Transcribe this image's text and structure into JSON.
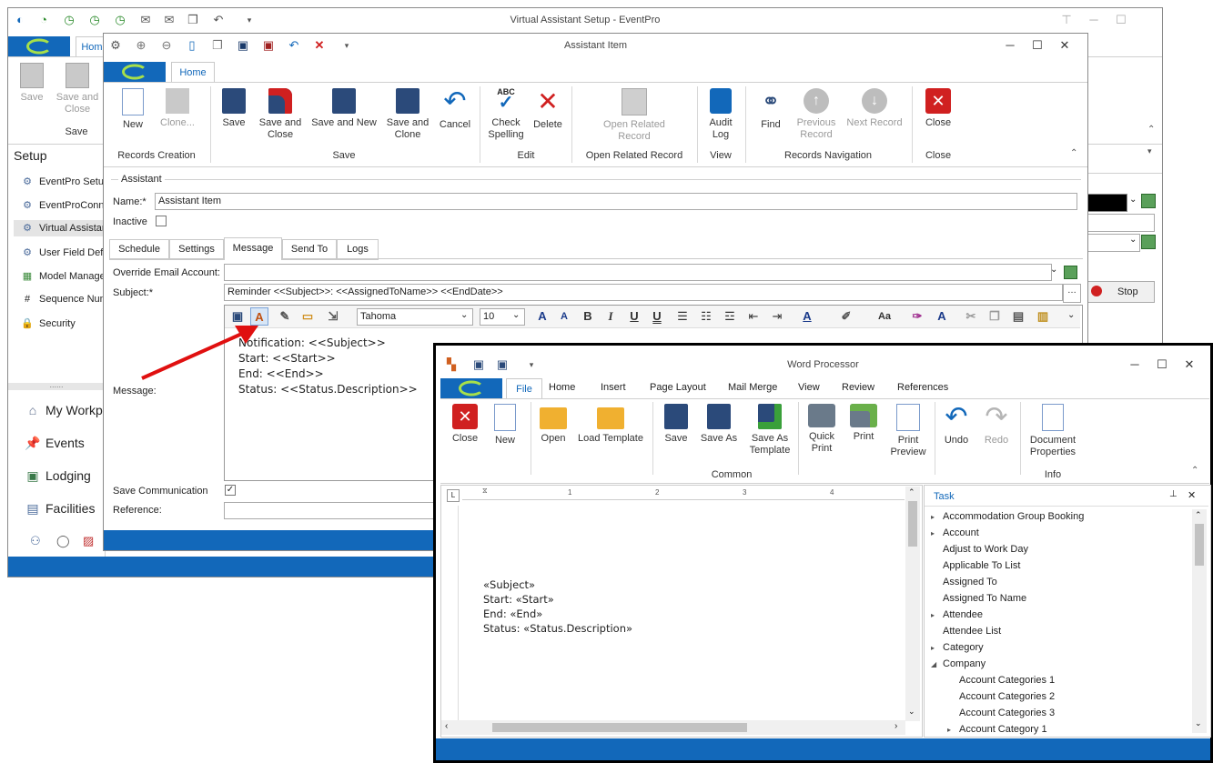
{
  "main_window": {
    "title": "Virtual Assistant Setup - EventPro",
    "tab_home": "Home",
    "save": {
      "line1": "Save",
      "line2": ""
    },
    "save_close": {
      "line1": "Save and",
      "line2": "Close"
    },
    "group_save": "Save",
    "sidebar_header": "Setup",
    "sidebar_items": [
      {
        "label": "EventPro Setup",
        "icon": "gear-icon"
      },
      {
        "label": "EventProConne",
        "icon": "gear-icon"
      },
      {
        "label": "Virtual Assistant",
        "icon": "gear-icon"
      },
      {
        "label": "User Field Defini",
        "icon": "gear-icon"
      },
      {
        "label": "Model Managem",
        "icon": "model-icon"
      },
      {
        "label": "Sequence Numb",
        "icon": "hash-icon"
      },
      {
        "label": "Security",
        "icon": "lock-icon"
      }
    ],
    "splitter": "......",
    "nav_items": [
      {
        "label": "My Workpla",
        "icon": "home-icon"
      },
      {
        "label": "Events",
        "icon": "pin-icon"
      },
      {
        "label": "Lodging",
        "icon": "lodging-icon"
      },
      {
        "label": "Facilities",
        "icon": "facilities-icon"
      }
    ],
    "stop_label": "Stop"
  },
  "assistant_window": {
    "title": "Assistant Item",
    "tab_home": "Home",
    "ribbon": {
      "new": {
        "line1": "New",
        "line2": ""
      },
      "clone": {
        "line1": "Clone...",
        "line2": ""
      },
      "save": {
        "line1": "Save",
        "line2": ""
      },
      "save_close": {
        "line1": "Save and",
        "line2": "Close"
      },
      "save_new": {
        "line1": "Save and New",
        "line2": ""
      },
      "save_clone": {
        "line1": "Save and",
        "line2": "Clone"
      },
      "cancel": {
        "line1": "Cancel",
        "line2": ""
      },
      "check_spelling": {
        "line1": "Check",
        "line2": "Spelling",
        "abc": "ABC"
      },
      "delete": {
        "line1": "Delete",
        "line2": ""
      },
      "open_related": {
        "line1": "Open Related",
        "line2": "Record"
      },
      "audit_log": {
        "line1": "Audit",
        "line2": "Log"
      },
      "find": {
        "line1": "Find",
        "line2": ""
      },
      "previous": {
        "line1": "Previous",
        "line2": "Record"
      },
      "next": {
        "line1": "Next Record",
        "line2": ""
      },
      "close": {
        "line1": "Close",
        "line2": ""
      }
    },
    "groups": {
      "records_creation": "Records Creation",
      "save": "Save",
      "edit": "Edit",
      "open_related": "Open Related Record",
      "view": "View",
      "records_navigation": "Records Navigation",
      "close": "Close"
    },
    "section_title": "Assistant",
    "name_label": "Name:*",
    "name_value": "Assistant Item",
    "inactive_label": "Inactive",
    "tabs": [
      "Schedule",
      "Settings",
      "Message",
      "Send To",
      "Logs"
    ],
    "override_label": "Override Email Account:",
    "override_value": "",
    "subject_label": "Subject:*",
    "subject_value": "Reminder <<Subject>>: <<AssignedToName>> <<EndDate>>",
    "font_name": "Tahoma",
    "font_size": "10",
    "message_label": "Message:",
    "message_lines": [
      "Notification: <<Subject>>",
      "Start: <<Start>>",
      "End: <<End>>",
      "Status: <<Status.Description>>"
    ],
    "save_comm_label": "Save Communication",
    "reference_label": "Reference:",
    "reference_value": ""
  },
  "word_window": {
    "title": "Word Processor",
    "tabs": [
      "File",
      "Home",
      "Insert",
      "Page Layout",
      "Mail Merge",
      "View",
      "Review",
      "References"
    ],
    "ribbon": {
      "close": {
        "line1": "Close",
        "line2": ""
      },
      "new": {
        "line1": "New",
        "line2": ""
      },
      "open": {
        "line1": "Open",
        "line2": ""
      },
      "load_template": {
        "line1": "Load Template",
        "line2": ""
      },
      "save": {
        "line1": "Save",
        "line2": ""
      },
      "save_as": {
        "line1": "Save As",
        "line2": ""
      },
      "save_as_template": {
        "line1": "Save As",
        "line2": "Template"
      },
      "quick_print": {
        "line1": "Quick",
        "line2": "Print"
      },
      "print": {
        "line1": "Print",
        "line2": ""
      },
      "print_preview": {
        "line1": "Print",
        "line2": "Preview"
      },
      "undo": {
        "line1": "Undo",
        "line2": ""
      },
      "redo": {
        "line1": "Redo",
        "line2": ""
      },
      "doc_props": {
        "line1": "Document",
        "line2": "Properties"
      }
    },
    "groups": {
      "common": "Common",
      "info": "Info"
    },
    "ruler_marker": "L",
    "ruler_numbers": [
      "1",
      "2",
      "3",
      "4"
    ],
    "doc_lines": [
      "«Subject»",
      "Start: «Start»",
      "End: «End»",
      "Status: «Status.Description»"
    ],
    "task_title": "Task",
    "tree": [
      {
        "label": "Accommodation Group Booking",
        "expander": "▸",
        "indent": 0
      },
      {
        "label": "Account",
        "expander": "▸",
        "indent": 0
      },
      {
        "label": "Adjust to Work Day",
        "expander": "",
        "indent": 0
      },
      {
        "label": "Applicable To List",
        "expander": "",
        "indent": 0
      },
      {
        "label": "Assigned To",
        "expander": "",
        "indent": 0
      },
      {
        "label": "Assigned To Name",
        "expander": "",
        "indent": 0
      },
      {
        "label": "Attendee",
        "expander": "▸",
        "indent": 0
      },
      {
        "label": "Attendee List",
        "expander": "",
        "indent": 0
      },
      {
        "label": "Category",
        "expander": "▸",
        "indent": 0
      },
      {
        "label": "Company",
        "expander": "◢",
        "indent": 0
      },
      {
        "label": "Account Categories 1",
        "expander": "",
        "indent": 1
      },
      {
        "label": "Account Categories 2",
        "expander": "",
        "indent": 1
      },
      {
        "label": "Account Categories 3",
        "expander": "",
        "indent": 1
      },
      {
        "label": "Account Category 1",
        "expander": "▸",
        "indent": 1
      }
    ]
  }
}
